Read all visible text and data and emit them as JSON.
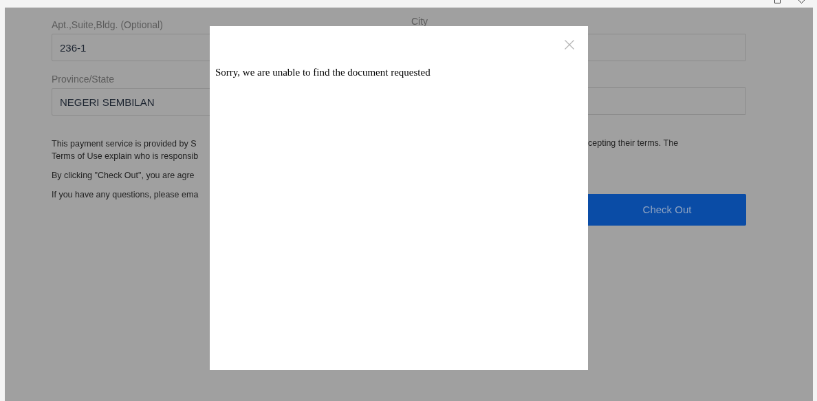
{
  "form": {
    "fields": [
      {
        "label": "Apt.,Suite,Bldg. (Optional)",
        "value": "236-1"
      },
      {
        "label": "Province/State",
        "value": "NEGERI SEMBILAN"
      }
    ],
    "city_label": "City",
    "notice_left": [
      "This payment service is provided by S",
      "Terms of Use explain who is responsib",
      "By clicking \"Check Out\", you are agre",
      "If you have any questions, please ema"
    ],
    "notice_right": "cepting their terms. The",
    "checkout_button": "Check Out"
  },
  "dialog": {
    "message": "Sorry, we are unable to find the document requested"
  }
}
